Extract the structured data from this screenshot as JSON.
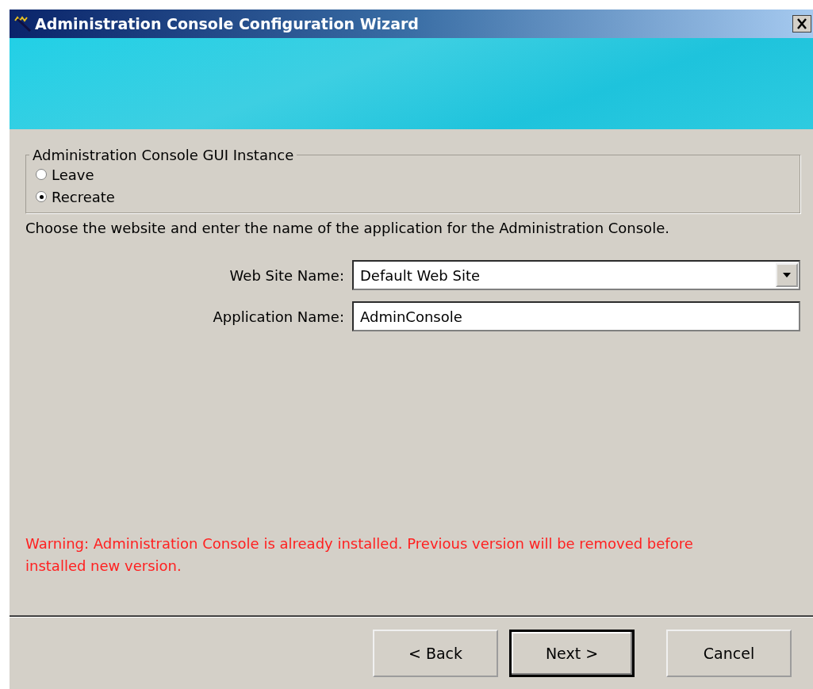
{
  "window": {
    "title": "Administration Console Configuration Wizard"
  },
  "instance_group": {
    "title": "Administration Console GUI Instance",
    "options": [
      {
        "label": "Leave",
        "selected": false
      },
      {
        "label": "Recreate",
        "selected": true
      }
    ]
  },
  "description": "Choose the website and enter the name of the application for the Administration Console.",
  "fields": [
    {
      "kind": "dropdown",
      "label": "Web Site Name:",
      "value": "Default Web Site"
    },
    {
      "kind": "text",
      "label": "Application Name:",
      "value": "AdminConsole"
    }
  ],
  "warning": "Warning: Administration Console is already installed. Previous version will be removed before installed new version.",
  "buttons": [
    {
      "label": "< Back",
      "default": false
    },
    {
      "label": "Next >",
      "default": true
    },
    {
      "label": "Cancel",
      "default": false
    }
  ]
}
